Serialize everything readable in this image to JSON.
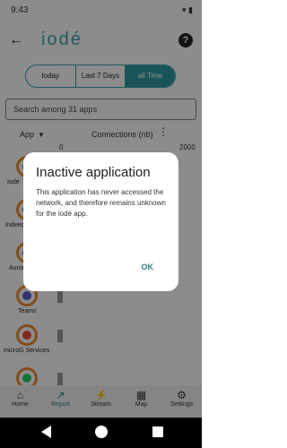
{
  "status_bar": {
    "time": "9:43",
    "icons": "▾ ▮"
  },
  "app_bar": {
    "back_icon": "←",
    "title": "iodé",
    "help_icon": "?"
  },
  "tabs": [
    {
      "label": "today",
      "active": false
    },
    {
      "label": "Last 7 Days",
      "active": false
    },
    {
      "label": "all Time",
      "active": true
    }
  ],
  "search": {
    "placeholder": "Search among 31 apps"
  },
  "table": {
    "col_app": "App",
    "sort_icon": "▼",
    "col_connections": "Connections (nb)",
    "more_icon": "⋮",
    "axis_min": "0",
    "axis_max": "2000"
  },
  "apps": [
    {
      "label": "Iodé",
      "color": "#2f9aa0"
    },
    {
      "label": "Indeed",
      "color": "#2557a7"
    },
    {
      "label": "Aurora",
      "color": "#3c7bd7"
    },
    {
      "label": "Teams",
      "color": "#5b5fc7"
    },
    {
      "label": "microG Services",
      "color": "#e84c3d"
    },
    {
      "label": "",
      "color": "#25d366"
    }
  ],
  "bottom_nav": [
    {
      "label": "Home",
      "icon": "⌂",
      "active": false
    },
    {
      "label": "Report",
      "icon": "↗",
      "active": true
    },
    {
      "label": "Stream",
      "icon": "⚡",
      "active": false
    },
    {
      "label": "Map",
      "icon": "▦",
      "active": false
    },
    {
      "label": "Settings",
      "icon": "⚙",
      "active": false
    }
  ],
  "dialog": {
    "title": "Inactive application",
    "body": "This application has never accessed the network, and therefore remains unknown for the iodé app.",
    "ok_label": "OK"
  }
}
